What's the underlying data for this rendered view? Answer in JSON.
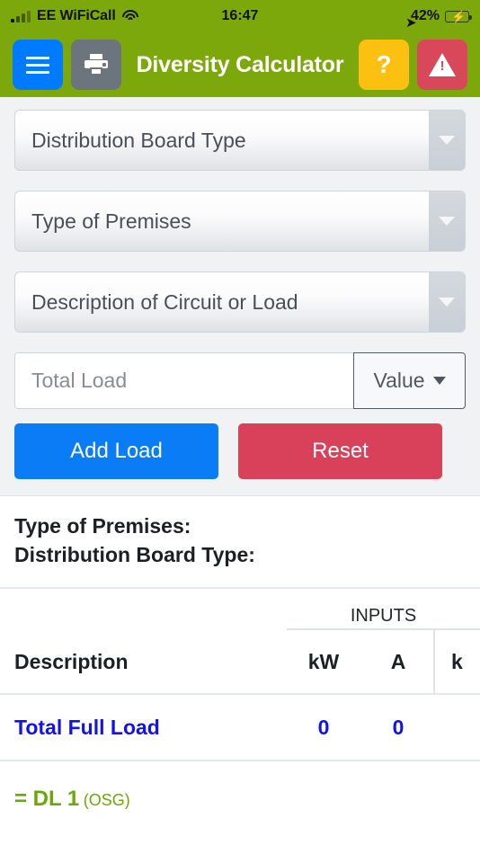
{
  "status_bar": {
    "carrier": "EE WiFiCall",
    "signal_icon": "signal-bars-icon",
    "wifi_icon": "wifi-icon",
    "time": "16:47",
    "location_icon": "location-arrow-icon",
    "battery_percent": "42%",
    "battery_icon": "battery-charging-icon",
    "battery_fill_color": "#4ed96a"
  },
  "app_bar": {
    "title": "Diversity Calculator",
    "menu_icon": "hamburger-menu-icon",
    "print_icon": "printer-icon",
    "help_label": "?",
    "warning_icon": "warning-triangle-icon",
    "bar_color": "#7da80c",
    "menu_color": "#007aff",
    "print_color": "#6c757d",
    "help_color": "#fcc011",
    "warning_color": "#d9475a"
  },
  "form": {
    "selects": [
      {
        "label": "Distribution Board Type",
        "name": "distribution-board-type"
      },
      {
        "label": "Type of Premises",
        "name": "type-of-premises"
      },
      {
        "label": "Description of Circuit or Load",
        "name": "description-of-circuit-or-load"
      }
    ],
    "total_load_placeholder": "Total Load",
    "total_load_value": "",
    "value_button_label": "Value",
    "add_load_label": "Add Load",
    "reset_label": "Reset",
    "add_color": "#0a7cf5",
    "reset_color": "#d9415a"
  },
  "results": {
    "meta": {
      "premises_label": "Type of Premises:",
      "board_label": "Distribution Board Type:"
    },
    "group_header": "INPUTS",
    "columns": {
      "description": "Description",
      "kw": "kW",
      "a": "A",
      "next_partial": "k"
    },
    "total_row": {
      "label": "Total Full Load",
      "kw": "0",
      "a": "0",
      "color": "#1212ee"
    },
    "dl_row": {
      "main": "= DL 1",
      "sub": "(OSG)",
      "color": "#6ca70a"
    }
  }
}
